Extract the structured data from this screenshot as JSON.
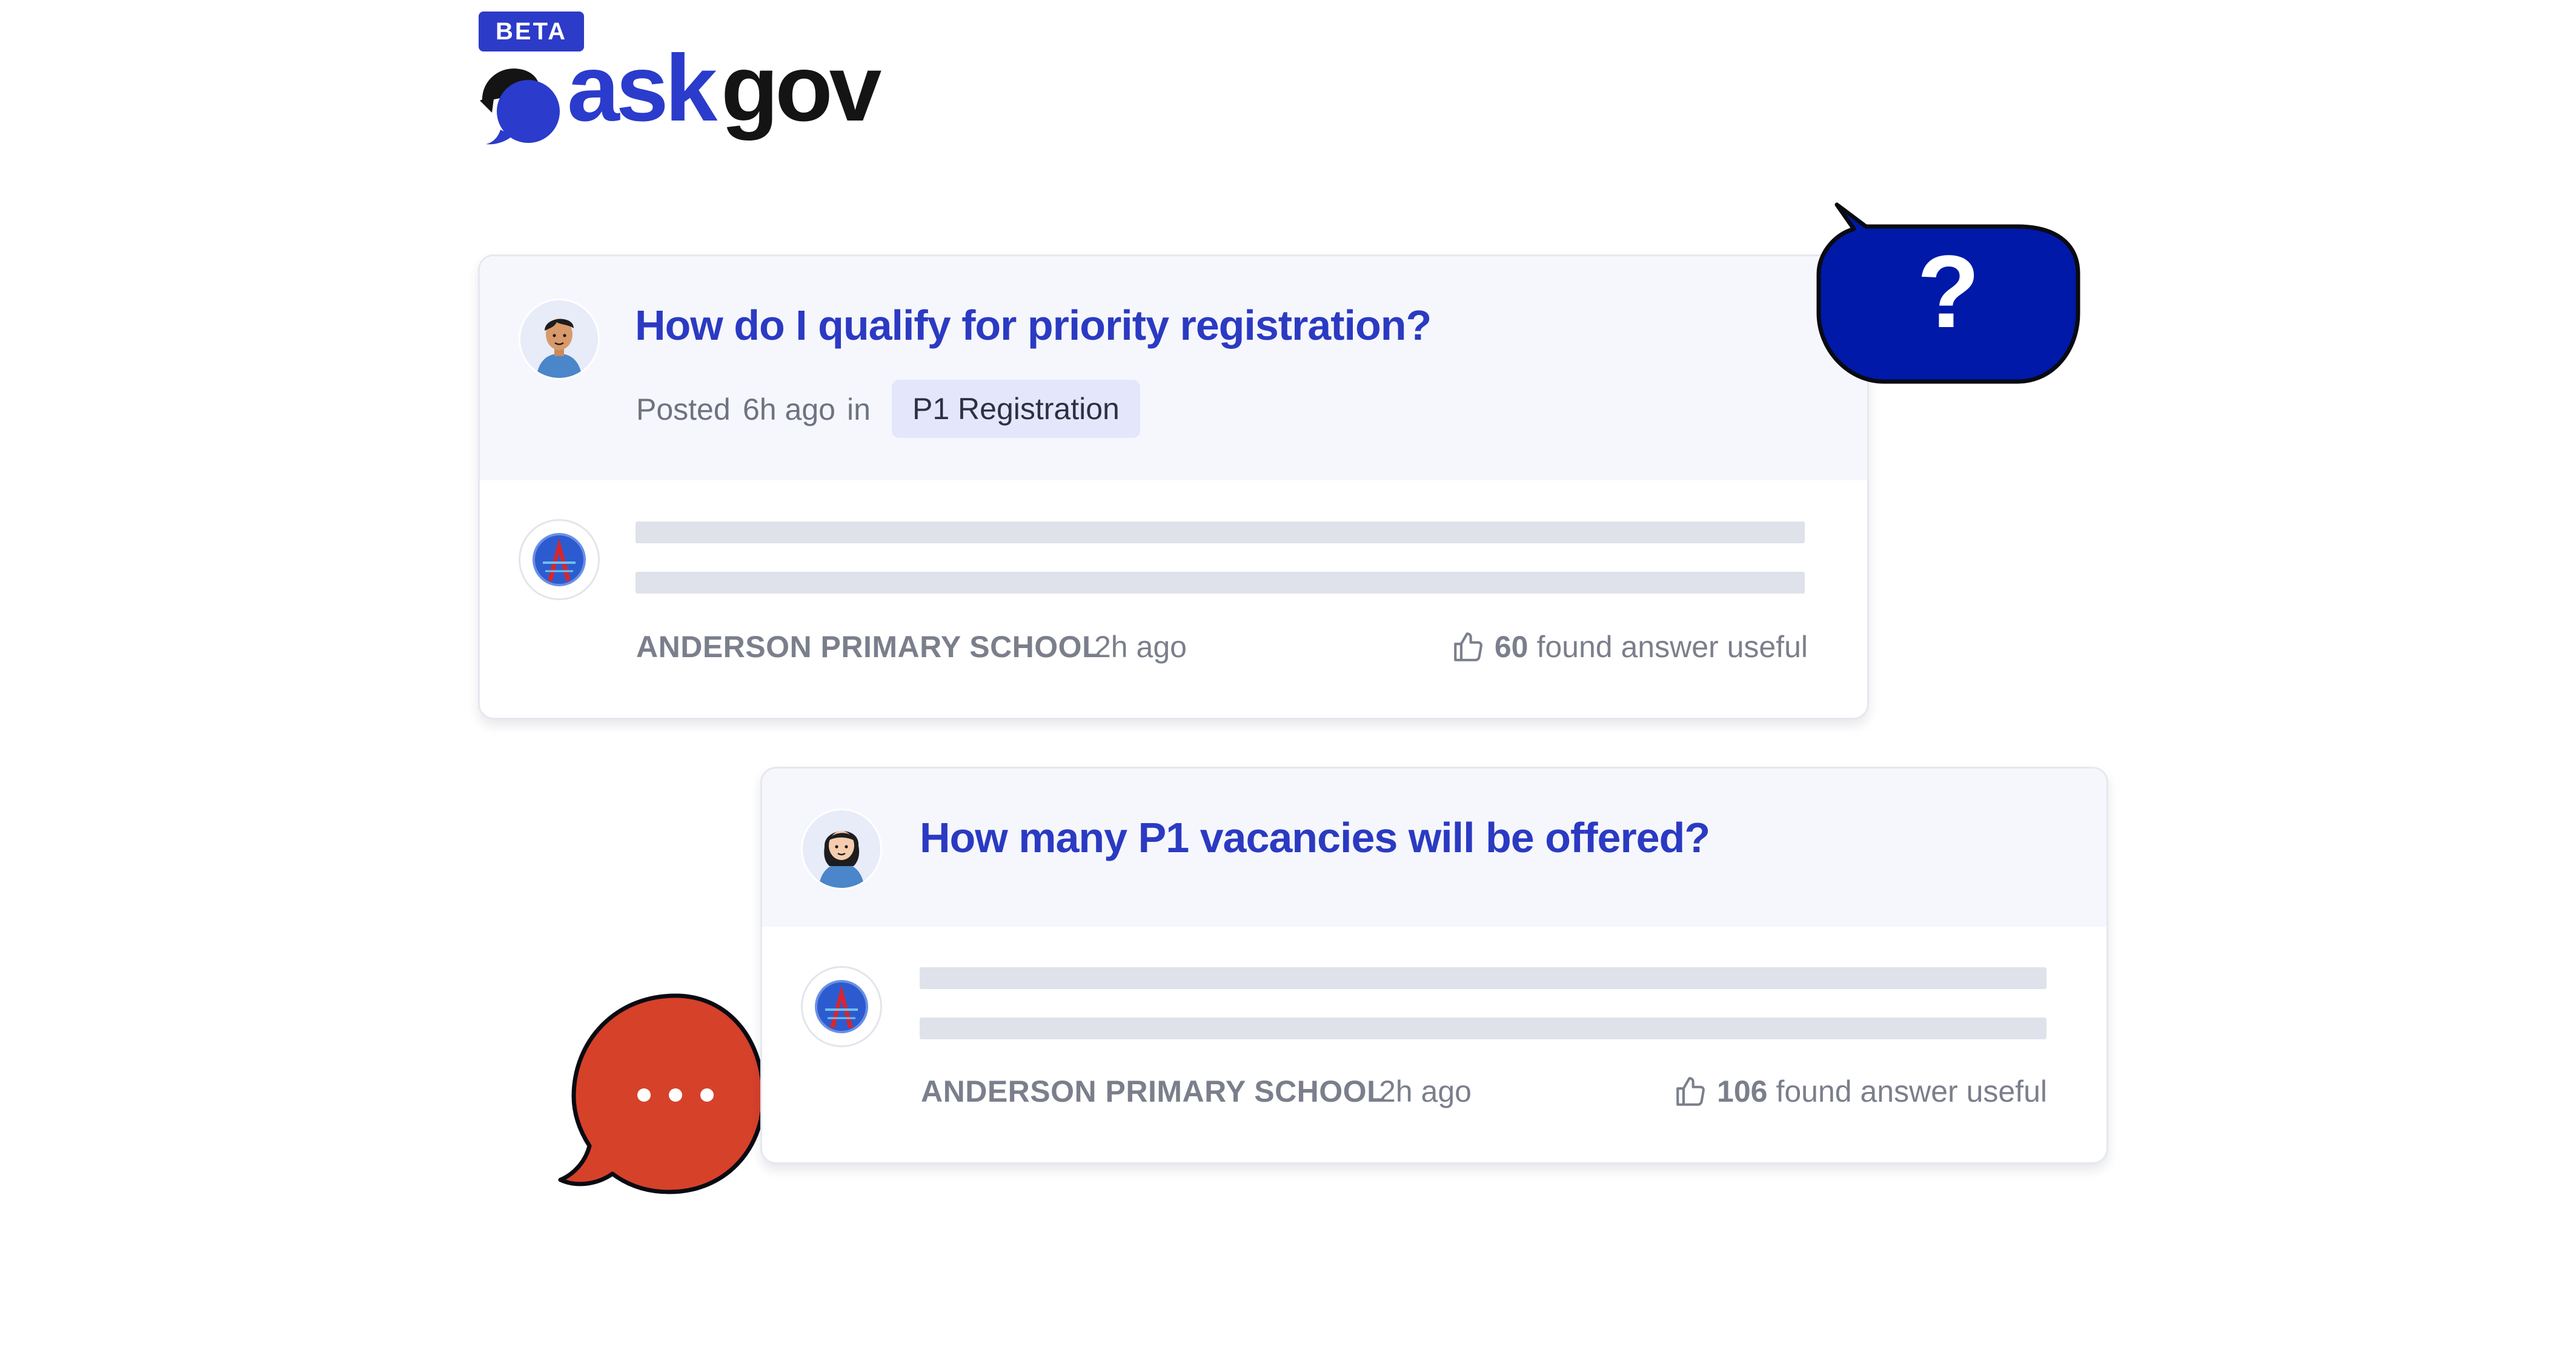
{
  "brand": {
    "beta_label": "BETA",
    "name_part1": "ask",
    "name_part2": "gov",
    "colors": {
      "primary": "#2b3bcc",
      "dark": "#141414"
    }
  },
  "questions": [
    {
      "title": "How do I qualify for priority registration?",
      "posted_prefix": "Posted",
      "posted_time": "6h ago",
      "posted_in": "in",
      "category": "P1 Registration",
      "avatar_icon": "male-user-avatar-icon",
      "answer": {
        "agency": "ANDERSON PRIMARY SCHOOL",
        "time": "2h ago",
        "useful_count": "60",
        "useful_label": "found answer useful",
        "agency_icon": "school-crest-icon"
      }
    },
    {
      "title": "How many P1 vacancies will be offered?",
      "avatar_icon": "female-user-avatar-icon",
      "answer": {
        "agency": "ANDERSON PRIMARY SCHOOL",
        "time": "2h ago",
        "useful_count": "106",
        "useful_label": "found answer useful",
        "agency_icon": "school-crest-icon"
      }
    }
  ],
  "decorations": {
    "question_bubble": {
      "glyph": "?",
      "color": "#0019a8"
    },
    "typing_bubble": {
      "glyph": "• • •",
      "color": "#d6412a"
    }
  }
}
